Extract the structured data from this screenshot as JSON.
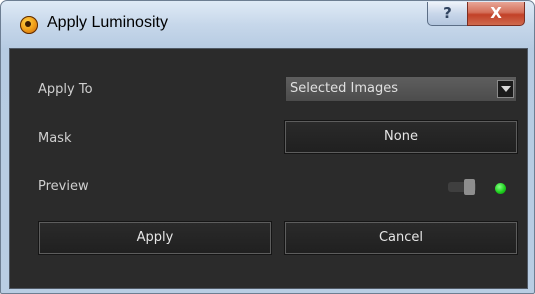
{
  "window": {
    "title": "Apply Luminosity",
    "help_label": "?",
    "close_label": "X",
    "icon": "luminosity-app-icon"
  },
  "form": {
    "apply_to": {
      "label": "Apply To",
      "value": "Selected Images"
    },
    "mask": {
      "label": "Mask",
      "value": "None"
    },
    "preview": {
      "label": "Preview",
      "toggle_state": "on",
      "led_color": "#1fd11f"
    }
  },
  "buttons": {
    "apply": "Apply",
    "cancel": "Cancel"
  }
}
